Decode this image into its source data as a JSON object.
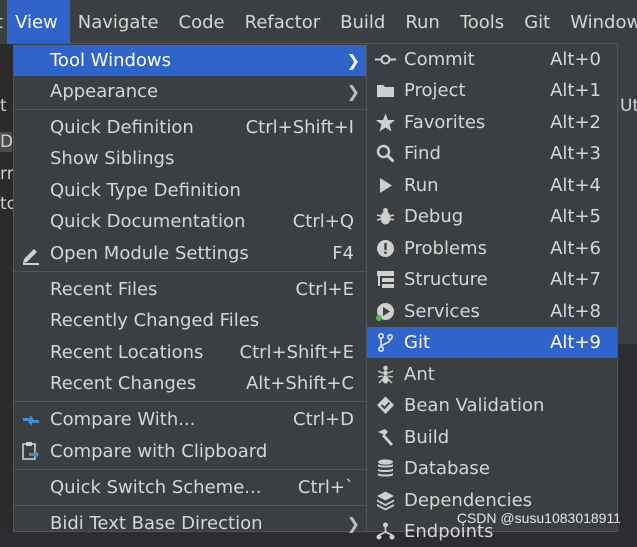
{
  "menubar": {
    "items": [
      {
        "label": "t"
      },
      {
        "label": "View",
        "active": true
      },
      {
        "label": "Navigate"
      },
      {
        "label": "Code"
      },
      {
        "label": "Refactor"
      },
      {
        "label": "Build"
      },
      {
        "label": "Run"
      },
      {
        "label": "Tools"
      },
      {
        "label": "Git"
      },
      {
        "label": "Window"
      }
    ]
  },
  "background": {
    "left_fragments": [
      "t",
      "D",
      "rr",
      "to"
    ],
    "right_fragment": "Ut"
  },
  "view_menu": {
    "items": [
      {
        "label": "Tool Windows",
        "submenu": true,
        "highlighted": true
      },
      {
        "label": "Appearance",
        "submenu": true
      },
      {
        "label": "Quick Definition",
        "shortcut": "Ctrl+Shift+I"
      },
      {
        "label": "Show Siblings",
        "shortcut": ""
      },
      {
        "label": "Quick Type Definition",
        "shortcut": ""
      },
      {
        "label": "Quick Documentation",
        "shortcut": "Ctrl+Q"
      },
      {
        "label": "Open Module Settings",
        "shortcut": "F4",
        "icon": "pencil-icon"
      },
      {
        "label": "Recent Files",
        "shortcut": "Ctrl+E"
      },
      {
        "label": "Recently Changed Files",
        "shortcut": ""
      },
      {
        "label": "Recent Locations",
        "shortcut": "Ctrl+Shift+E"
      },
      {
        "label": "Recent Changes",
        "shortcut": "Alt+Shift+C"
      },
      {
        "label": "Compare With...",
        "shortcut": "Ctrl+D",
        "icon": "compare-icon"
      },
      {
        "label": "Compare with Clipboard",
        "shortcut": "",
        "icon": "clipboard-compare-icon"
      },
      {
        "label": "Quick Switch Scheme...",
        "shortcut": "Ctrl+`"
      },
      {
        "label": "Bidi Text Base Direction",
        "submenu": true
      }
    ]
  },
  "tool_windows_menu": {
    "items": [
      {
        "label": "Commit",
        "shortcut": "Alt+0",
        "icon": "commit-icon"
      },
      {
        "label": "Project",
        "shortcut": "Alt+1",
        "icon": "folder-icon"
      },
      {
        "label": "Favorites",
        "shortcut": "Alt+2",
        "icon": "star-icon"
      },
      {
        "label": "Find",
        "shortcut": "Alt+3",
        "icon": "search-icon"
      },
      {
        "label": "Run",
        "shortcut": "Alt+4",
        "icon": "play-icon"
      },
      {
        "label": "Debug",
        "shortcut": "Alt+5",
        "icon": "bug-icon"
      },
      {
        "label": "Problems",
        "shortcut": "Alt+6",
        "icon": "warning-icon"
      },
      {
        "label": "Structure",
        "shortcut": "Alt+7",
        "icon": "structure-icon"
      },
      {
        "label": "Services",
        "shortcut": "Alt+8",
        "icon": "services-icon"
      },
      {
        "label": "Git",
        "shortcut": "Alt+9",
        "icon": "git-branch-icon",
        "highlighted": true
      },
      {
        "label": "Ant",
        "shortcut": "",
        "icon": "ant-icon"
      },
      {
        "label": "Bean Validation",
        "shortcut": "",
        "icon": "bean-validation-icon"
      },
      {
        "label": "Build",
        "shortcut": "",
        "icon": "hammer-icon"
      },
      {
        "label": "Database",
        "shortcut": "",
        "icon": "database-icon"
      },
      {
        "label": "Dependencies",
        "shortcut": "",
        "icon": "dependencies-icon"
      },
      {
        "label": "Endpoints",
        "shortcut": "",
        "icon": "endpoints-icon"
      }
    ]
  },
  "watermark": "CSDN @susu1083018911",
  "colors": {
    "menu_bg": "#3c3f41",
    "highlight": "#2f65ca",
    "text": "#d6d6d6",
    "separator": "#555555"
  }
}
